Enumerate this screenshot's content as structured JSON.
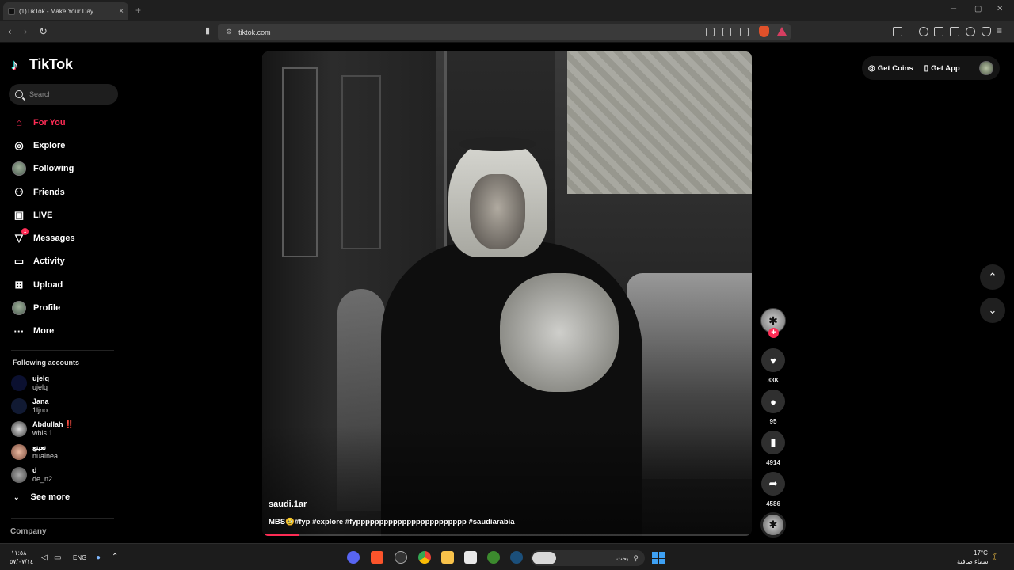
{
  "browser": {
    "tab_title": "(1)TikTok - Make Your Day",
    "tab_close": "×",
    "new_tab": "+",
    "url": "tiktok.com"
  },
  "sidebar": {
    "logo_text": "TikTok",
    "search_placeholder": "Search",
    "nav": [
      {
        "label": "For You",
        "icon": "home-icon",
        "active": true
      },
      {
        "label": "Explore",
        "icon": "compass-icon"
      },
      {
        "label": "Following",
        "icon": "following-avatar-icon"
      },
      {
        "label": "Friends",
        "icon": "friends-icon"
      },
      {
        "label": "LIVE",
        "icon": "live-icon"
      },
      {
        "label": "Messages",
        "icon": "messages-icon",
        "badge": "1"
      },
      {
        "label": "Activity",
        "icon": "activity-icon"
      },
      {
        "label": "Upload",
        "icon": "upload-icon"
      },
      {
        "label": "Profile",
        "icon": "profile-avatar-icon"
      },
      {
        "label": "More",
        "icon": "more-icon"
      }
    ],
    "following_title": "Following accounts",
    "accounts": [
      {
        "name": "ujelq",
        "handle": "ujelq"
      },
      {
        "name": "Jana",
        "handle": "1ljno"
      },
      {
        "name": "Abdullah ‼️",
        "handle": "wbls.1"
      },
      {
        "name": "نعينع",
        "handle": "nuainea"
      },
      {
        "name": "d",
        "handle": "de_n2"
      }
    ],
    "see_more": "See more",
    "company": "Company"
  },
  "video": {
    "author": "saudi.1ar",
    "caption": "MBS🥹#fyp #explore #fypppppppppppppppppppppppp #saudiarabia",
    "progress": 0.07
  },
  "actions": {
    "follow_plus": "+",
    "likes": "33K",
    "comments": "95",
    "saves": "4914",
    "shares": "4586"
  },
  "topright": {
    "get_coins": "Get Coins",
    "get_app": "Get App"
  },
  "taskbar": {
    "time": "١١:٥٨",
    "date": "٥٧/٠٧/١٤",
    "lang": "ENG",
    "search_text": "بحث",
    "temp": "17°C",
    "weather": "سماء صافية"
  },
  "colors": {
    "accent": "#fe2c55",
    "background": "#000000",
    "windows_blue": "#3ea1f4"
  }
}
